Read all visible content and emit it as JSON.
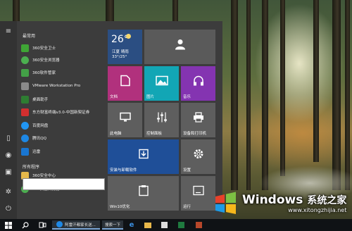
{
  "start_menu": {
    "section_frequent": "最常用",
    "section_all_apps": "所有程序",
    "frequent_apps": [
      {
        "label": "360安全卫士",
        "icon": "360-safe-icon",
        "color": "#3fa535"
      },
      {
        "label": "360安全浏览器",
        "icon": "360-browser-icon",
        "color": "#4caf50"
      },
      {
        "label": "360软件管家",
        "icon": "360-software-icon",
        "color": "#43a047"
      },
      {
        "label": "VMware Workstation Pro",
        "icon": "vmware-icon",
        "color": "#8a8a8a"
      },
      {
        "label": "桌面助手",
        "icon": "desktop-assistant-icon",
        "color": "#2e7d32"
      },
      {
        "label": "东方财富终端v3.0-中国新契证券",
        "icon": "eastmoney-icon",
        "color": "#d32f2f"
      },
      {
        "label": "百度网盘",
        "icon": "baidu-netdisk-icon",
        "color": "#2196f3"
      },
      {
        "label": "腾讯QQ",
        "icon": "qq-icon",
        "color": "#1e88e5"
      },
      {
        "label": "迅雷",
        "icon": "xunlei-icon",
        "color": "#1976d2"
      }
    ],
    "all_apps": [
      {
        "label": "360安全中心",
        "icon": "folder-icon",
        "color": "#e6b84a"
      },
      {
        "label": "360安全浏览器",
        "icon": "360-browser-icon",
        "color": "#4caf50"
      }
    ],
    "tiles": {
      "weather": {
        "temp": "26°",
        "city": "江夏 晴雨",
        "range": "33°/25°"
      },
      "documents": "文档",
      "pictures": "图片",
      "music": "音乐",
      "this_pc": "此电脑",
      "control_panel": "控制面板",
      "devices_printers": "设备和打印机",
      "install_uninstall": "安装与卸载软件",
      "settings": "设置",
      "win10_optimize": "Win10优化",
      "run": "运行"
    }
  },
  "taskbar": {
    "window_label": "阿雷汗都家长送...",
    "window_label_2": "搜索一下"
  },
  "watermark": {
    "brand": "Windows",
    "site": "系统之家",
    "url": "www.xitongzhijia.net"
  }
}
